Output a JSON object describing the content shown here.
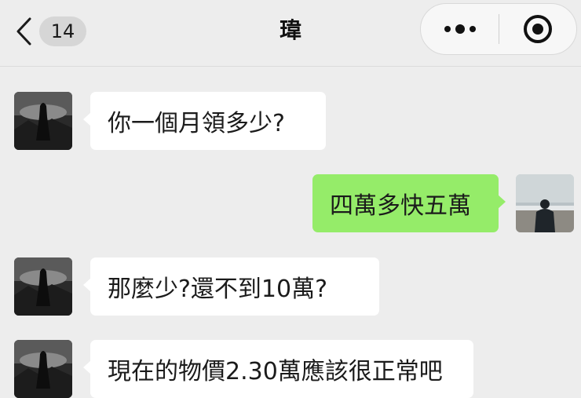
{
  "header": {
    "back_icon": "chevron-left-icon",
    "unread_count": "14",
    "title": "瑋",
    "more_icon": "more-dots-icon",
    "close_icon": "target-circle-icon"
  },
  "messages": [
    {
      "side": "in",
      "text": "你一個月領多少?"
    },
    {
      "side": "out",
      "text": "四萬多快五萬"
    },
    {
      "side": "in",
      "text": "那麼少?還不到10萬?"
    },
    {
      "side": "in",
      "text": "現在的物價2.30萬應該很正常吧"
    }
  ],
  "colors": {
    "background": "#ededed",
    "incoming_bubble": "#ffffff",
    "outgoing_bubble": "#95ec69"
  }
}
